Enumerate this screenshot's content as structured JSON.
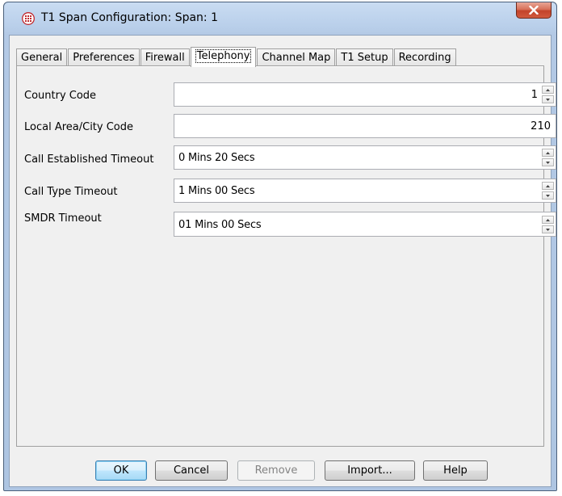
{
  "window": {
    "title": "T1 Span Configuration: Span: 1",
    "close_symbol": "✕"
  },
  "tabs": [
    {
      "label": "General"
    },
    {
      "label": "Preferences"
    },
    {
      "label": "Firewall"
    },
    {
      "label": "Telephony",
      "active": true
    },
    {
      "label": "Channel Map"
    },
    {
      "label": "T1 Setup"
    },
    {
      "label": "Recording"
    }
  ],
  "fields": {
    "country_code": {
      "label": "Country Code",
      "value": "1"
    },
    "area_code": {
      "label": "Local Area/City Code",
      "value": "210"
    },
    "call_established_timeout": {
      "label": "Call Established Timeout",
      "value": "0 Mins  20 Secs"
    },
    "call_type_timeout": {
      "label": "Call Type Timeout",
      "value": "1 Mins  00 Secs"
    },
    "smdr_timeout": {
      "label": "SMDR Timeout",
      "value": "01 Mins  00 Secs"
    }
  },
  "buttons": {
    "ok": "OK",
    "cancel": "Cancel",
    "remove": "Remove",
    "import": "Import...",
    "help": "Help"
  },
  "colors": {
    "title_accent": "#c3432a",
    "app_icon": "#c0282d",
    "default_button_border": "#3c7fb1"
  }
}
